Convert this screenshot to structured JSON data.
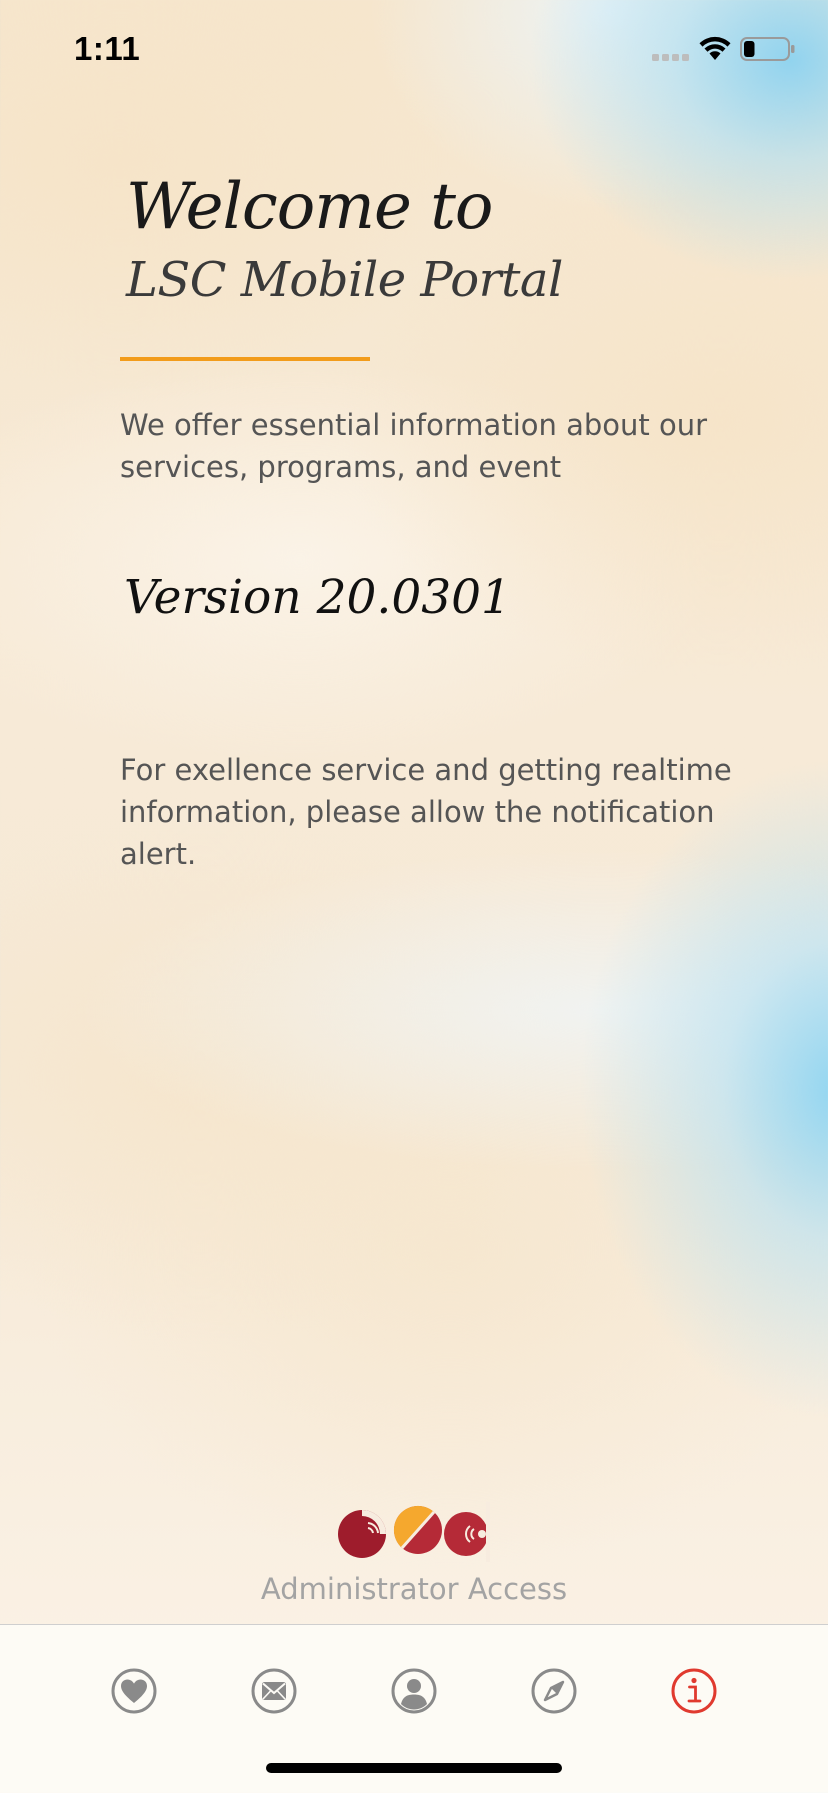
{
  "status_bar": {
    "time": "1:11",
    "icons": [
      "cellular-signal-icon",
      "wifi-icon",
      "battery-icon"
    ],
    "battery_level": 0.25
  },
  "welcome": {
    "line1": "Welcome to",
    "line2": "LSC Mobile Portal"
  },
  "intro_text": "We offer essential information about our services, programs, and event",
  "version_text": "Version 20.0301",
  "notification_text": "For exellence service and getting realtime information, please allow the notification alert.",
  "admin": {
    "label": "Administrator Access",
    "logo_icon": "lsc-logo-icon"
  },
  "tab_bar": {
    "items": [
      {
        "icon": "heart-icon",
        "active": false
      },
      {
        "icon": "envelope-icon",
        "active": false
      },
      {
        "icon": "person-icon",
        "active": false
      },
      {
        "icon": "compass-icon",
        "active": false
      },
      {
        "icon": "info-icon",
        "active": true
      }
    ],
    "active_color": "#e03a2f",
    "inactive_color": "#8a8a8a"
  },
  "colors": {
    "accent_divider": "#f29c1b",
    "body_text": "#555555",
    "muted_text": "#a3a3a3",
    "logo_red": "#b52a37",
    "logo_dark_red": "#9e1c2c",
    "logo_orange": "#f5a82e"
  }
}
